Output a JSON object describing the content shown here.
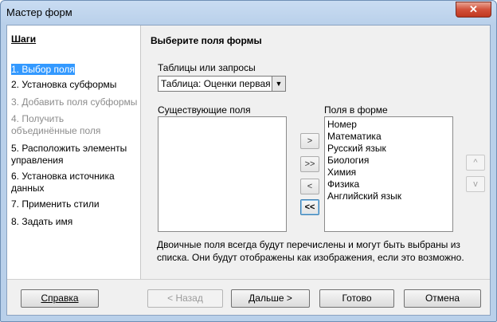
{
  "window": {
    "title": "Мастер форм",
    "close_glyph": "✕"
  },
  "sidebar": {
    "title": "Шаги",
    "steps": [
      {
        "label": "1. Выбор поля",
        "state": "active"
      },
      {
        "label": "2. Установка субформы",
        "state": "normal"
      },
      {
        "label": "3. Добавить поля субформы",
        "state": "disabled"
      },
      {
        "label": "4. Получить объединённые поля",
        "state": "disabled"
      },
      {
        "label": "5. Расположить элементы управления",
        "state": "normal"
      },
      {
        "label": "6. Установка источника данных",
        "state": "normal"
      },
      {
        "label": "7. Применить стили",
        "state": "normal"
      },
      {
        "label": "8. Задать имя",
        "state": "normal"
      }
    ]
  },
  "main": {
    "heading": "Выберите поля формы",
    "tables_label": "Таблицы или запросы",
    "table_select_value": "Таблица: Оценки первая четверть",
    "existing_fields_label": "Существующие поля",
    "existing_fields": [],
    "form_fields_label": "Поля в форме",
    "form_fields": [
      "Номер",
      "Математика",
      "Русский язык",
      "Биология",
      "Химия",
      "Физика",
      "Английский язык"
    ],
    "move_buttons": {
      "add_one": ">",
      "add_all": ">>",
      "remove_one": "<",
      "remove_all": "<<"
    },
    "order_buttons": {
      "up": "^",
      "down": "v"
    },
    "note": "Двоичные поля всегда будут перечислены и могут быть выбраны из списка. Они будут отображены как изображения, если это возможно."
  },
  "footer": {
    "help": "Справка",
    "back": "< Назад",
    "next": "Дальше >",
    "finish": "Готово",
    "cancel": "Отмена"
  }
}
